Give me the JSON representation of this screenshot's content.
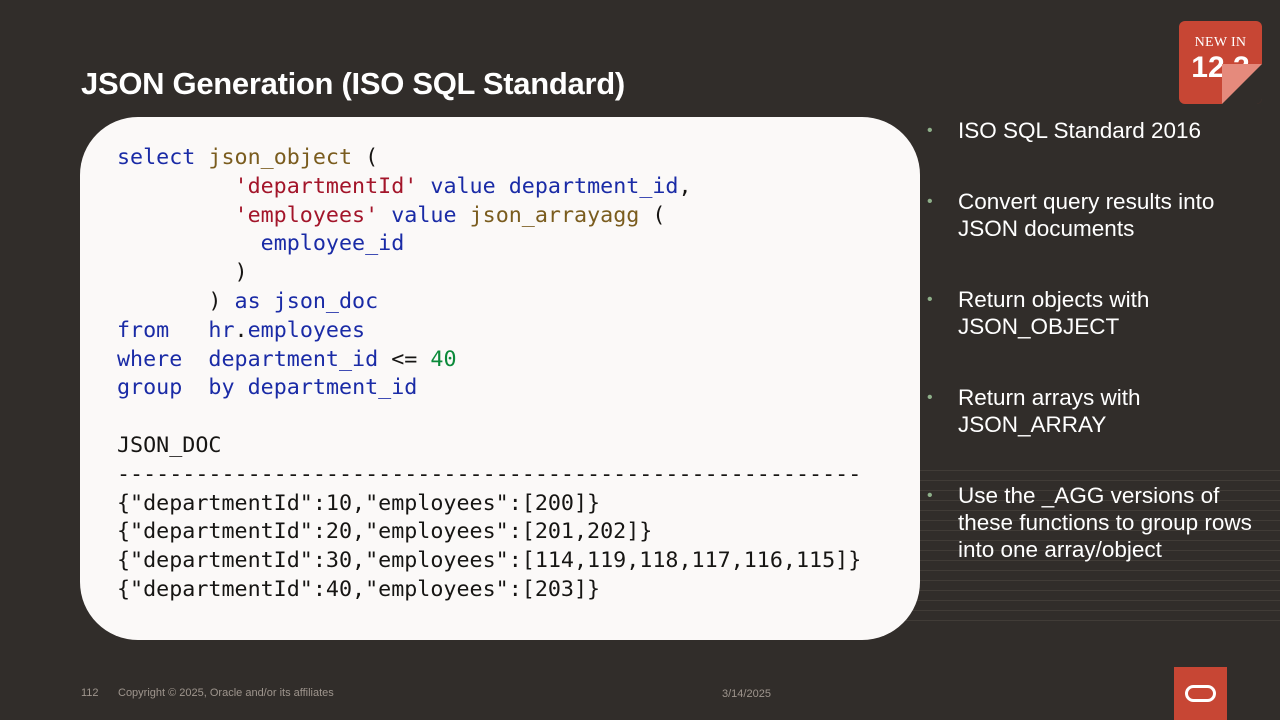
{
  "slide": {
    "title": "JSON Generation (ISO SQL Standard)",
    "badge": {
      "top": "NEW IN",
      "version": "12.2"
    }
  },
  "code": {
    "lines": [
      [
        {
          "t": "select",
          "c": "kw"
        },
        {
          "t": " "
        },
        {
          "t": "json_object",
          "c": "fn"
        },
        {
          "t": " ("
        }
      ],
      [
        {
          "t": "         "
        },
        {
          "t": "'departmentId'",
          "c": "str"
        },
        {
          "t": " "
        },
        {
          "t": "value",
          "c": "kw"
        },
        {
          "t": " "
        },
        {
          "t": "department_id",
          "c": "kw"
        },
        {
          "t": ","
        }
      ],
      [
        {
          "t": "         "
        },
        {
          "t": "'employees'",
          "c": "str"
        },
        {
          "t": " "
        },
        {
          "t": "value",
          "c": "kw"
        },
        {
          "t": " "
        },
        {
          "t": "json_arrayagg",
          "c": "fn"
        },
        {
          "t": " ("
        }
      ],
      [
        {
          "t": "           "
        },
        {
          "t": "employee_id",
          "c": "kw"
        }
      ],
      [
        {
          "t": "         )"
        }
      ],
      [
        {
          "t": "       ) "
        },
        {
          "t": "as",
          "c": "kw"
        },
        {
          "t": " "
        },
        {
          "t": "json_doc",
          "c": "kw"
        }
      ],
      [
        {
          "t": "from",
          "c": "kw"
        },
        {
          "t": "   "
        },
        {
          "t": "hr",
          "c": "kw"
        },
        {
          "t": "."
        },
        {
          "t": "employees",
          "c": "kw"
        }
      ],
      [
        {
          "t": "where",
          "c": "kw"
        },
        {
          "t": "  "
        },
        {
          "t": "department_id",
          "c": "kw"
        },
        {
          "t": " <= "
        },
        {
          "t": "40",
          "c": "num"
        }
      ],
      [
        {
          "t": "group",
          "c": "kw"
        },
        {
          "t": "  "
        },
        {
          "t": "by",
          "c": "kw"
        },
        {
          "t": " "
        },
        {
          "t": "department_id",
          "c": "kw"
        }
      ],
      [
        {
          "t": ""
        }
      ],
      [
        {
          "t": "JSON_DOC"
        }
      ],
      [
        {
          "t": "---------------------------------------------------------"
        }
      ],
      [
        {
          "t": "{\"departmentId\":10,\"employees\":[200]}"
        }
      ],
      [
        {
          "t": "{\"departmentId\":20,\"employees\":[201,202]}"
        }
      ],
      [
        {
          "t": "{\"departmentId\":30,\"employees\":[114,119,118,117,116,115]}"
        }
      ],
      [
        {
          "t": "{\"departmentId\":40,\"employees\":[203]}"
        }
      ]
    ]
  },
  "bullets": {
    "marker": "•",
    "items": [
      "ISO SQL Standard 2016",
      "Convert query results into JSON documents",
      "Return objects with JSON_OBJECT",
      "Return arrays with JSON_ARRAY",
      "Use the _AGG versions of these functions  to group rows into one array/object"
    ]
  },
  "footer": {
    "page_number": "112",
    "copyright": "Copyright © 2025, Oracle and/or its affiliates",
    "date": "3/14/2025"
  },
  "colors": {
    "background": "#312d2a",
    "accent": "#c74634",
    "keyword": "#1a2ba6",
    "function": "#7a5c1e",
    "string": "#a3152a",
    "number": "#0b8a3a",
    "bullet": "#8fb08a"
  },
  "icons": {
    "logo": "oracle-logo-icon"
  }
}
